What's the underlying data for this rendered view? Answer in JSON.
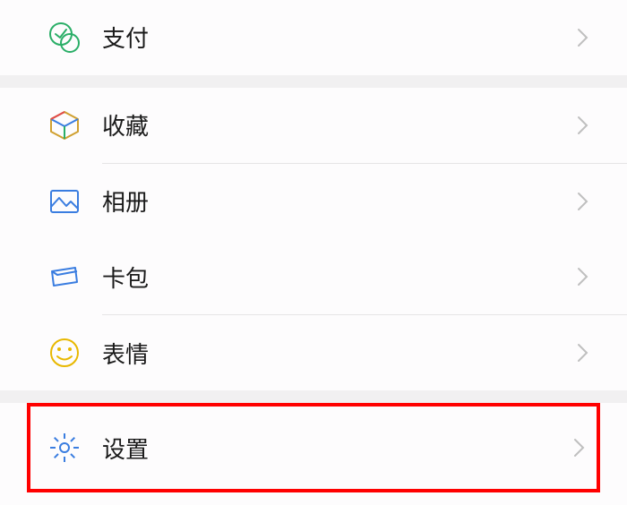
{
  "menu": {
    "pay": {
      "label": "支付"
    },
    "favorites": {
      "label": "收藏"
    },
    "album": {
      "label": "相册"
    },
    "cards": {
      "label": "卡包"
    },
    "stickers": {
      "label": "表情"
    },
    "settings": {
      "label": "设置"
    }
  }
}
